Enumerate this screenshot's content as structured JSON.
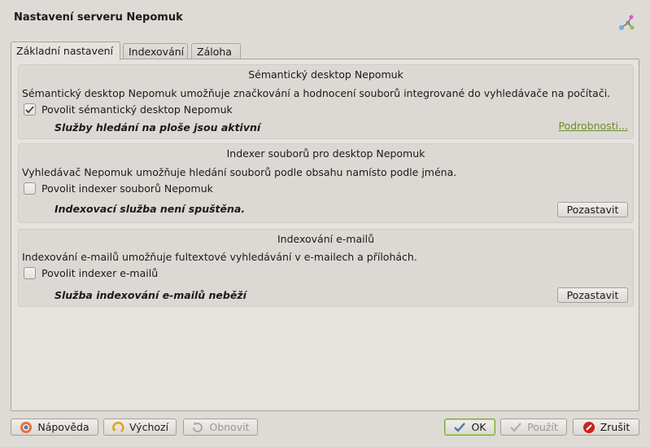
{
  "window": {
    "title": "Nastavení serveru Nepomuk",
    "icon": "nepomuk-icon"
  },
  "tabs": [
    {
      "label": "Základní nastavení",
      "active": true
    },
    {
      "label": "Indexování",
      "active": false
    },
    {
      "label": "Záloha",
      "active": false
    }
  ],
  "groups": {
    "semantic": {
      "title": "Sémantický desktop Nepomuk",
      "description": "Sémantický desktop Nepomuk umožňuje značkování a hodnocení souborů integrované do vyhledávače na počítači.",
      "checkbox_label": "Povolit sémantický desktop Nepomuk",
      "checked": true,
      "status": "Služby hledání na ploše jsou aktivní",
      "link": "Podrobnosti..."
    },
    "indexer": {
      "title": "Indexer souborů pro desktop Nepomuk",
      "description": "Vyhledávač Nepomuk umožňuje hledání souborů podle obsahu namísto podle jména.",
      "checkbox_label": "Povolit indexer souborů Nepomuk",
      "checked": false,
      "status": "Indexovací služba není spuštěna.",
      "button": "Pozastavit"
    },
    "email": {
      "title": "Indexování e-mailů",
      "description": "Indexování e-mailů umožňuje fultextové vyhledávání v e-mailech a přílohách.",
      "checkbox_label": "Povolit indexer e-mailů",
      "checked": false,
      "status": "Služba indexování e-mailů neběží",
      "button": "Pozastavit"
    }
  },
  "footer": {
    "help": "Nápověda",
    "defaults": "Výchozí",
    "reset": "Obnovit",
    "ok": "OK",
    "apply": "Použít",
    "cancel": "Zrušit"
  },
  "colors": {
    "link": "#6f8a2e",
    "default_button_border": "#7ea63a"
  }
}
